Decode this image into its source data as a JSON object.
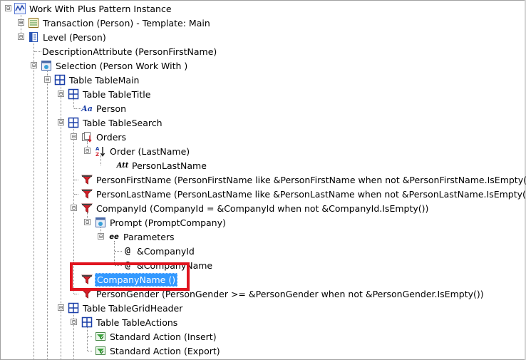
{
  "tree": {
    "root": {
      "label": "Work With Plus Pattern Instance",
      "icon": "pattern-icon"
    },
    "transaction": {
      "label": "Transaction (Person) - Template: Main",
      "icon": "transaction-icon"
    },
    "level": {
      "label": "Level (Person)",
      "icon": "level-icon"
    },
    "description_attribute": {
      "label": "DescriptionAttribute (PersonFirstName)"
    },
    "selection": {
      "label": "Selection (Person Work With )",
      "icon": "selection-icon"
    },
    "table_main": {
      "label": "Table TableMain",
      "icon": "table-icon"
    },
    "table_title": {
      "label": "Table TableTitle",
      "icon": "table-icon"
    },
    "title_text": {
      "label": "Person",
      "icon": "text-block-icon",
      "icon_glyph": "Aa"
    },
    "table_search": {
      "label": "Table TableSearch",
      "icon": "table-icon"
    },
    "orders": {
      "label": "Orders",
      "icon": "orders-icon"
    },
    "order_lastname": {
      "label": "Order (LastName)",
      "icon": "sort-az-icon"
    },
    "order_attr": {
      "label": "PersonLastName",
      "icon": "attribute-icon",
      "icon_glyph": "Att"
    },
    "filter_firstname": {
      "label": "PersonFirstName (PersonFirstName like &PersonFirstName when not &PersonFirstName.IsEmpty())",
      "icon": "filter-icon"
    },
    "filter_lastname": {
      "label": "PersonLastName (PersonLastName like &PersonLastName when not &PersonLastName.IsEmpty())",
      "icon": "filter-icon"
    },
    "filter_companyid": {
      "label": "CompanyId (CompanyId = &CompanyId when not &CompanyId.IsEmpty())",
      "icon": "filter-icon"
    },
    "prompt": {
      "label": "Prompt (PromptCompany)",
      "icon": "prompt-icon"
    },
    "parameters": {
      "label": "Parameters",
      "icon": "parameters-icon",
      "icon_glyph": "ee"
    },
    "param_companyid": {
      "label": "&CompanyId",
      "icon": "variable-icon",
      "icon_glyph": "@"
    },
    "param_companyname": {
      "label": "&CompanyName",
      "icon": "variable-icon",
      "icon_glyph": "@"
    },
    "filter_companyname": {
      "label": "CompanyName ()",
      "icon": "filter-icon",
      "selected": true
    },
    "filter_gender": {
      "label": "PersonGender (PersonGender >= &PersonGender when not &PersonGender.IsEmpty())",
      "icon": "filter-icon"
    },
    "table_grid_header": {
      "label": "Table TableGridHeader",
      "icon": "table-icon"
    },
    "table_actions": {
      "label": "Table TableActions",
      "icon": "table-icon"
    },
    "action_insert": {
      "label": "Standard Action (Insert)",
      "icon": "action-icon"
    },
    "action_export": {
      "label": "Standard Action (Export)",
      "icon": "action-icon"
    },
    "toggle_expanded": "⊟",
    "toggle_collapsed": "⊞"
  },
  "colors": {
    "selection": "#3399ff",
    "highlight_box": "#e0141e",
    "filter_icon": "#d0202a",
    "table_icon": "#1a3fa8"
  }
}
